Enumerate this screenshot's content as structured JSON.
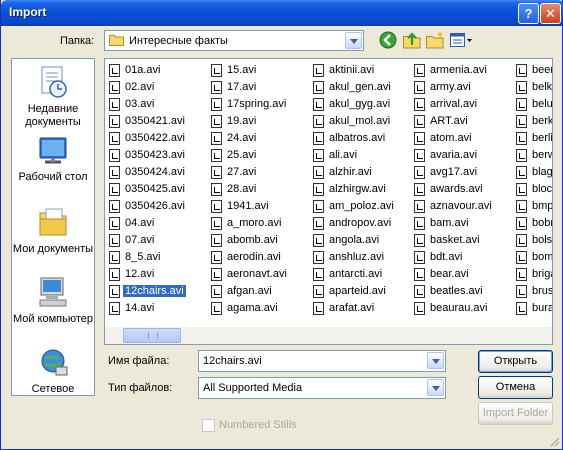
{
  "window": {
    "title": "Import"
  },
  "titlebar": {
    "help_glyph": "?",
    "close_glyph": "✕"
  },
  "lookin": {
    "label": "Папка:",
    "value": "Интересные факты"
  },
  "places": [
    {
      "label": "Недавние документы",
      "icon": "recent-documents-icon"
    },
    {
      "label": "Рабочий стол",
      "icon": "desktop-icon"
    },
    {
      "label": "Мои документы",
      "icon": "my-documents-icon"
    },
    {
      "label": "Мой компьютер",
      "icon": "my-computer-icon"
    },
    {
      "label": "Сетевое",
      "icon": "network-icon"
    }
  ],
  "files": {
    "columns": [
      [
        "01a.avi",
        "02.avi",
        "03.avi",
        "0350421.avi",
        "0350422.avi",
        "0350423.avi",
        "0350424.avi",
        "0350425.avi",
        "0350426.avi",
        "04.avi",
        "07.avi",
        "8_5.avi",
        "12.avi",
        "12chairs.avi",
        "14.avi"
      ],
      [
        "15.avi",
        "17.avi",
        "17spring.avi",
        "19.avi",
        "24.avi",
        "25.avi",
        "27.avi",
        "28.avi",
        "1941.avi",
        "a_moro.avi",
        "abomb.avi",
        "aerodin.avi",
        "aeronavt.avi",
        "afgan.avi",
        "agama.avi"
      ],
      [
        "aktinii.avi",
        "akul_gen.avi",
        "akul_gyg.avi",
        "akul_mol.avi",
        "albatros.avi",
        "ali.avi",
        "alzhir.avi",
        "alzhirgw.avi",
        "am_poloz.avi",
        "andropov.avi",
        "angola.avi",
        "anshluz.avi",
        "antarcti.avi",
        "aparteid.avi",
        "arafat.avi"
      ],
      [
        "armenia.avi",
        "army.avi",
        "arrival.avi",
        "ART.avi",
        "atom.avi",
        "avaria.avi",
        "avg17.avi",
        "awards.avi",
        "aznavour.avi",
        "bam.avi",
        "basket.avi",
        "bdt.avi",
        "bear.avi",
        "beatles.avi",
        "beaurau.avi"
      ],
      [
        "beer",
        "belk",
        "belu",
        "berk",
        "berli",
        "berw",
        "blag",
        "bloc",
        "bmp",
        "bobr",
        "bolsl",
        "bom",
        "briga",
        "brus",
        "bura"
      ]
    ],
    "selected": "12chairs.avi"
  },
  "filename": {
    "label": "Имя файла:",
    "value": "12chairs.avi"
  },
  "filetype": {
    "label": "Тип файлов:",
    "value": "All Supported Media"
  },
  "buttons": {
    "open": "Открыть",
    "cancel": "Отмена",
    "import_folder": "Import Folder"
  },
  "numbered_stills": {
    "label": "Numbered Stills",
    "checked": false
  }
}
